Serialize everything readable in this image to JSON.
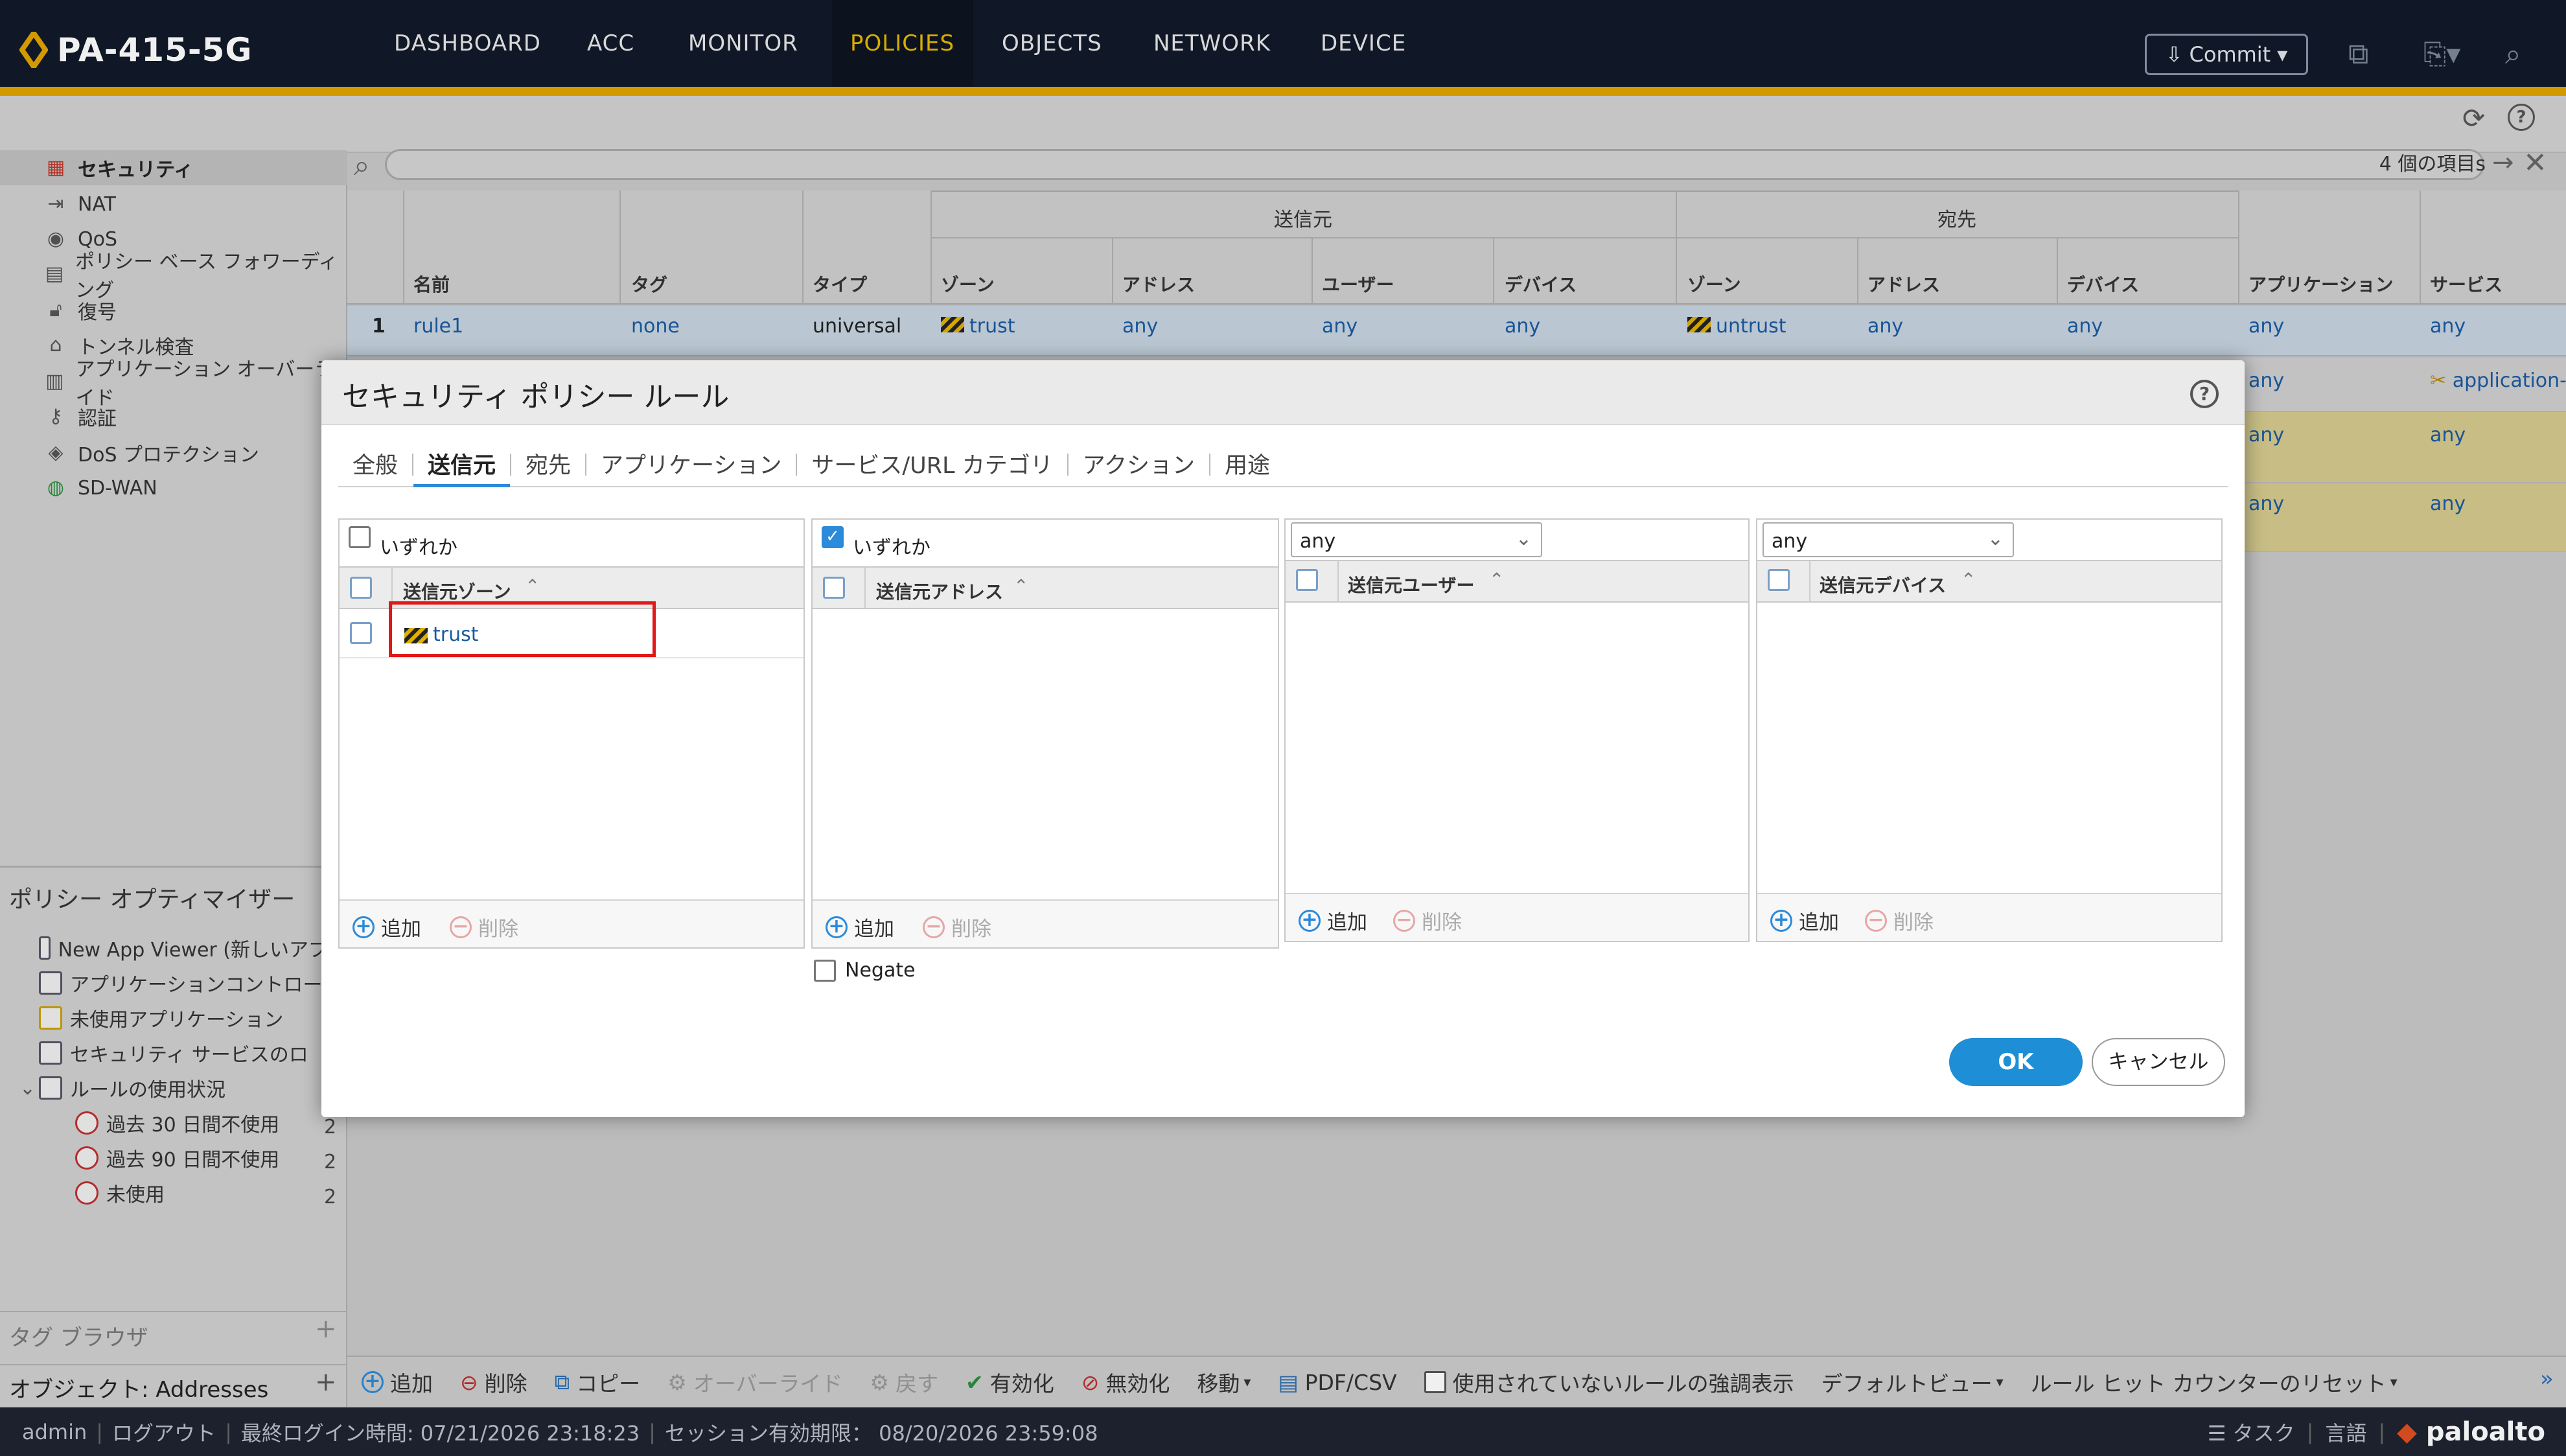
{
  "device": {
    "name": "PA-415-5G"
  },
  "nav": {
    "tabs": [
      "DASHBOARD",
      "ACC",
      "MONITOR",
      "POLICIES",
      "OBJECTS",
      "NETWORK",
      "DEVICE"
    ],
    "active": "POLICIES",
    "commit_label": "Commit"
  },
  "sidebar": {
    "items": [
      {
        "label": "セキュリティ",
        "icon": "security-rule-icon",
        "selected": true
      },
      {
        "label": "NAT",
        "icon": "nat-icon"
      },
      {
        "label": "QoS",
        "icon": "qos-icon"
      },
      {
        "label": "ポリシー ベース フォワーディング",
        "icon": "pbf-icon"
      },
      {
        "label": "復号",
        "icon": "decryption-icon"
      },
      {
        "label": "トンネル検査",
        "icon": "tunnel-icon"
      },
      {
        "label": "アプリケーション オーバーライド",
        "icon": "app-override-icon"
      },
      {
        "label": "認証",
        "icon": "auth-icon"
      },
      {
        "label": "DoS プロテクション",
        "icon": "dos-icon"
      },
      {
        "label": "SD-WAN",
        "icon": "sdwan-icon"
      }
    ]
  },
  "optimizer": {
    "title": "ポリシー オプティマイザー",
    "items": [
      {
        "label": "New App Viewer (新しいアプリ",
        "count": ""
      },
      {
        "label": "アプリケーションコントロール",
        "count": ""
      },
      {
        "label": "未使用アプリケーション",
        "count": ""
      },
      {
        "label": "セキュリティ サービスのロ",
        "count": ""
      },
      {
        "label": "ルールの使用状況",
        "count": ""
      },
      {
        "label": "過去 30 日間不使用",
        "count": "2"
      },
      {
        "label": "過去 90 日間不使用",
        "count": "2"
      },
      {
        "label": "未使用",
        "count": "2"
      }
    ]
  },
  "tag_browser": "タグ ブラウザ",
  "object_browser": "オブジェクト: Addresses",
  "search": {
    "item_count": "4 個の項目s"
  },
  "table": {
    "group_headers": {
      "source": "送信元",
      "destination": "宛先"
    },
    "columns": {
      "name": "名前",
      "tag": "タグ",
      "type": "タイプ",
      "src_zone": "ゾーン",
      "src_addr": "アドレス",
      "src_user": "ユーザー",
      "src_device": "デバイス",
      "dst_zone": "ゾーン",
      "dst_addr": "アドレス",
      "dst_device": "デバイス",
      "application": "アプリケーション",
      "service": "サービス"
    },
    "rows": [
      {
        "num": "1",
        "name": "rule1",
        "tag": "none",
        "type": "universal",
        "src_zone": "trust",
        "src_addr": "any",
        "src_user": "any",
        "src_device": "any",
        "dst_zone": "untrust",
        "dst_addr": "any",
        "dst_device": "any",
        "application": "any",
        "service": "any"
      },
      {
        "application": "any",
        "service": "application-"
      },
      {
        "application": "any",
        "service": "any"
      },
      {
        "application": "any",
        "service": "any"
      }
    ]
  },
  "dialog": {
    "title": "セキュリティ ポリシー ルール",
    "tabs": [
      "全般",
      "送信元",
      "宛先",
      "アプリケーション",
      "サービス/URL カテゴリ",
      "アクション",
      "用途"
    ],
    "active_tab": "送信元",
    "any_label": "いずれか",
    "zone_panel": {
      "header": "送信元ゾーン",
      "any_checked": false,
      "entries": [
        "trust"
      ]
    },
    "address_panel": {
      "header": "送信元アドレス",
      "any_checked": true
    },
    "user_panel": {
      "header": "送信元ユーザー",
      "select": "any"
    },
    "device_panel": {
      "header": "送信元デバイス",
      "select": "any"
    },
    "add_label": "追加",
    "delete_label": "削除",
    "negate_label": "Negate",
    "ok_label": "OK",
    "cancel_label": "キャンセル"
  },
  "bottom_toolbar": {
    "add": "追加",
    "delete": "削除",
    "copy": "コピー",
    "override": "オーバーライド",
    "revert": "戻す",
    "enable": "有効化",
    "disable": "無効化",
    "move": "移動",
    "pdf": "PDF/CSV",
    "highlight_unused": "使用されていないルールの強調表示",
    "default_view": "デフォルトビュー",
    "reset_counter": "ルール ヒット カウンターのリセット"
  },
  "status": {
    "user": "admin",
    "logout": "ログアウト",
    "last_login": "最終ログイン時間: 07/21/2026 23:18:23",
    "session_expire": "セッション有効期限： 08/20/2026 23:59:08",
    "tasks": "タスク",
    "language": "言語",
    "brand": "paloalto"
  },
  "colors": {
    "accent": "#e0a400",
    "nav_bg": "#111a2a",
    "link": "#1a5aa0",
    "ok": "#1e8fd6",
    "highlight": "#e01818"
  }
}
